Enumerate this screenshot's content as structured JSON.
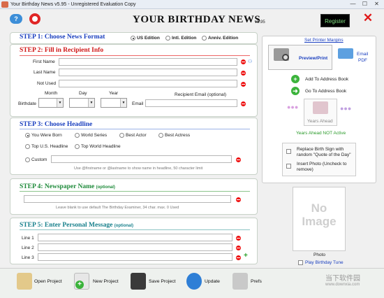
{
  "window": {
    "title": "Your Birthday News v5.95 - Unregistered Evaluation Copy",
    "controls": {
      "minimize": "—",
      "maximize": "☐",
      "close": "✕"
    }
  },
  "header": {
    "logo": "YOUR BIRTHDAY NEWS",
    "version": "v5.95",
    "register_label": "Register"
  },
  "step1": {
    "title": "STEP 1: Choose News Format",
    "options": [
      "US Edition",
      "Intl. Edition",
      "Anniv. Edition"
    ],
    "selected": "US Edition"
  },
  "step2": {
    "title": "STEP 2: Fill in Recipient Info",
    "fields": {
      "first_name": "First Name",
      "last_name": "Last Name",
      "not_used": "Not Used"
    },
    "date_headers": {
      "month": "Month",
      "day": "Day",
      "year": "Year"
    },
    "birthdate_label": "Birthdate",
    "email_header": "Recipient Email (optional)",
    "email_label": "Email"
  },
  "step3": {
    "title": "STEP 3: Choose Headline",
    "options": [
      "You Were Born",
      "World Series",
      "Best Actor",
      "Best Actress",
      "Top U.S. Headline",
      "Top World Headline"
    ],
    "custom_label": "Custom",
    "hint": "Use @firstname or @lastname to show name in headline, 50 character limit"
  },
  "step4": {
    "title": "STEP 4: Newspaper Name",
    "optional": "(optional)",
    "hint": "Leave blank to use default The Birthday Examiner, 34 char. max. 0 Used"
  },
  "step5": {
    "title": "STEP 5: Enter Personal Message",
    "optional": "(optional)",
    "lines": [
      "Line 1",
      "Line 2",
      "Line 3"
    ]
  },
  "right": {
    "printer_link": "Set Printer Margins",
    "preview_label": "Preview/Print",
    "email_pdf_label_1": "Email",
    "email_pdf_label_2": "PDF",
    "add_address": "Add To Address Book",
    "goto_address": "Go To Address Book",
    "years_ahead": "Years Ahead",
    "years_ahead_status": "Years Ahead NOT Active",
    "replace_sign": "Replace Birth Sign with random \"Quote of the Day\"",
    "insert_photo": "Insert Photo (Uncheck to remove)",
    "no_image_1": "No",
    "no_image_2": "Image",
    "photo_label": "Photo",
    "play_tune": "Play Birthday Tune"
  },
  "toolbar": {
    "open": "Open Project",
    "new": "New Project",
    "save": "Save Project",
    "update": "Update",
    "prefs": "Prefs"
  },
  "watermark": {
    "text": "当下软件园",
    "url": "www.downxia.com"
  }
}
